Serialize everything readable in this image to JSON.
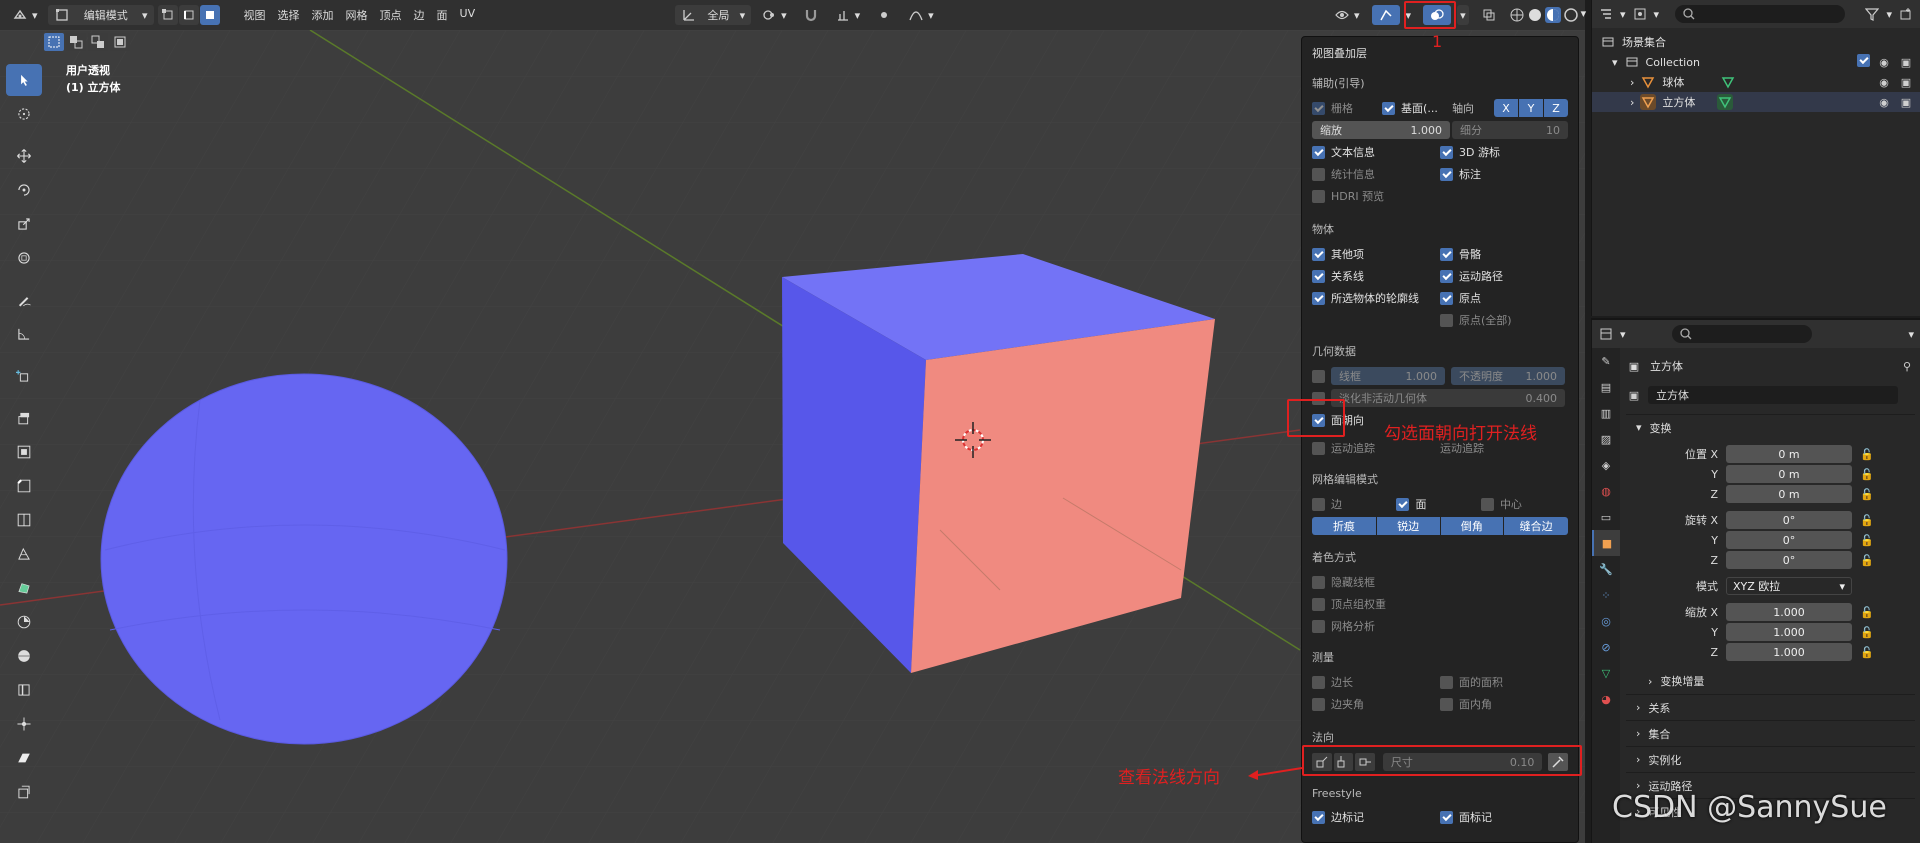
{
  "header": {
    "mode": "编辑模式",
    "menus": [
      "视图",
      "选择",
      "添加",
      "网格",
      "顶点",
      "边",
      "面",
      "UV"
    ],
    "transform_orientation": "全局"
  },
  "viewport": {
    "view_name": "用户透视",
    "object_info": "(1) 立方体"
  },
  "overlay": {
    "title": "视图叠加层",
    "guides": {
      "heading": "辅助(引导)",
      "grid": "栅格",
      "floor": "基面(...",
      "axes_label": "轴向",
      "axes": [
        "X",
        "Y",
        "Z"
      ],
      "scale_label": "缩放",
      "scale_value": "1.000",
      "subdiv_label": "细分",
      "subdiv_value": "10",
      "text_info": "文本信息",
      "cursor_3d": "3D 游标",
      "statistics": "统计信息",
      "annotations": "标注",
      "hdri": "HDRI 预览"
    },
    "objects": {
      "heading": "物体",
      "extras": "其他项",
      "bones": "骨骼",
      "relations": "关系线",
      "motion_paths": "运动路径",
      "outline": "所选物体的轮廓线",
      "origins": "原点",
      "origins_all": "原点(全部)"
    },
    "geometry": {
      "heading": "几何数据",
      "wireframe_label": "线框",
      "wireframe_value": "1.000",
      "opacity_label": "不透明度",
      "opacity_value": "1.000",
      "fade_label": "淡化非活动几何体",
      "fade_value": "0.400",
      "face_orientation": "面朝向",
      "motion_tracking": "运动追踪",
      "motion_tracking_right": "运动追踪"
    },
    "mesh_edit": {
      "heading": "网格编辑模式",
      "edges": "边",
      "faces": "面",
      "center": "中心",
      "buttons": [
        "折痕",
        "锐边",
        "倒角",
        "缝合边"
      ]
    },
    "shading": {
      "heading": "着色方式",
      "hidden_wire": "隐藏线框",
      "vertex_group_weights": "顶点组权重",
      "mesh_analysis": "网格分析"
    },
    "measurement": {
      "heading": "测量",
      "edge_length": "边长",
      "face_area": "面的面积",
      "edge_angle": "边夹角",
      "face_angle": "面内角"
    },
    "normals": {
      "heading": "法向",
      "size_label": "尺寸",
      "size_value": "0.10"
    },
    "freestyle": {
      "heading": "Freestyle",
      "edge_marks": "边标记",
      "face_marks": "面标记"
    }
  },
  "annotations": {
    "marker_number": "1",
    "face_orientation_note": "勾选面朝向打开法线",
    "normals_note": "查看法线方向"
  },
  "outliner": {
    "root": "场景集合",
    "collection": "Collection",
    "items": [
      "球体",
      "立方体"
    ]
  },
  "properties": {
    "object_name_header": "立方体",
    "object_name_field": "立方体",
    "transform": {
      "heading": "变换",
      "location_label": "位置 X",
      "location": [
        "0 m",
        "0 m",
        "0 m"
      ],
      "rotation_label": "旋转 X",
      "rotation": [
        "0°",
        "0°",
        "0°"
      ],
      "mode_label": "模式",
      "mode_value": "XYZ 欧拉",
      "scale_label": "缩放 X",
      "scale": [
        "1.000",
        "1.000",
        "1.000"
      ],
      "axis_y": "Y",
      "axis_z": "Z",
      "delta": "变换增量"
    },
    "panels": [
      "关系",
      "集合",
      "实例化",
      "运动路径",
      "可见性"
    ]
  },
  "watermark": "CSDN @SannySue",
  "colors": {
    "accent": "#4772b3",
    "face_front": "#f08a80",
    "face_back": "#6e6ef5",
    "annotation_red": "#e02020"
  }
}
